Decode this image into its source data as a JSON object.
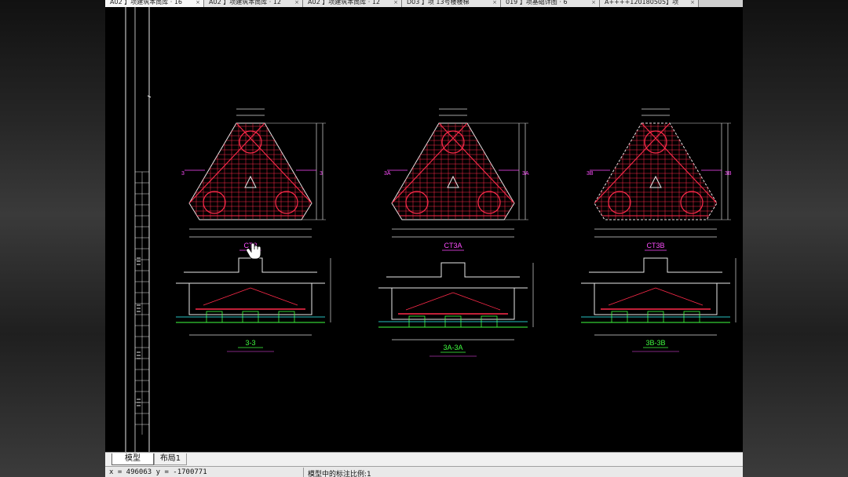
{
  "doc_tabs": [
    {
      "label": "A02 】项建筑本筒库 · 16",
      "active": true
    },
    {
      "label": "A02 】项建筑本筒库 · 12",
      "active": false
    },
    {
      "label": "A02 】项建筑本筒库 · 12",
      "active": false
    },
    {
      "label": "D03 】项 13号楼楼梯",
      "active": false
    },
    {
      "label": "019 】项基础详图 · 6",
      "active": false
    },
    {
      "label": "A++++120180505】项",
      "active": false
    }
  ],
  "drawing": {
    "colors": {
      "background": "#000000",
      "rebar": "#ff2a4a",
      "outline": "#e8e8e8",
      "dim": "#d8d8d8",
      "label": "#ff4dff",
      "section": "#40ff40",
      "note": "#ffff33",
      "cyan": "#33ffff"
    },
    "plans": [
      {
        "label": "CT3",
        "side_marker": "3"
      },
      {
        "label": "CT3A",
        "side_marker": "3A"
      },
      {
        "label": "CT3B",
        "side_marker": "3B"
      }
    ],
    "sections": [
      {
        "label": "3-3"
      },
      {
        "label": "3A-3A"
      },
      {
        "label": "3B-3B"
      }
    ]
  },
  "layout_tabs": {
    "model": "模型",
    "layout1": "布局1"
  },
  "status": {
    "coordinates": "x = 496063 y = -1700771",
    "annotation_scale": "模型中的标注比例:1"
  }
}
